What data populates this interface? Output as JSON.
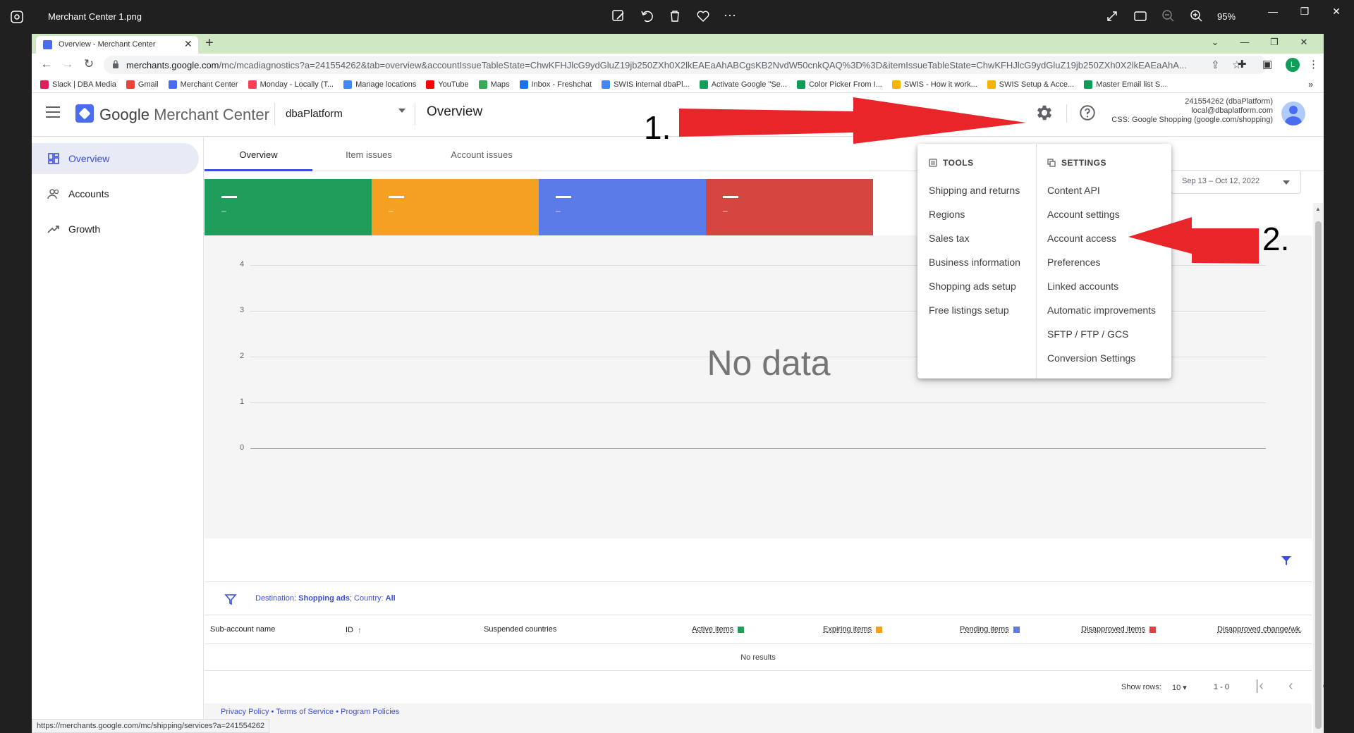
{
  "viewer": {
    "file_name": "Merchant Center 1.png",
    "zoom": "95%"
  },
  "browser": {
    "tab_title": "Overview - Merchant Center",
    "url_host": "merchants.google.com",
    "url_path": "/mc/mcadiagnostics?a=241554262&tab=overview&accountIssueTableState=ChwKFHJlcG9ydGluZ19jb250ZXh0X2lkEAEaAhABCgsKB2NvdW50cnkQAQ%3D%3D&itemIssueTableState=ChwKFHJlcG9ydGluZ19jb250ZXh0X2lkEAEaAhA...",
    "profile_initial": "L",
    "bookmarks": [
      {
        "label": "Slack | DBA Media",
        "color": "#e01e5a"
      },
      {
        "label": "Gmail",
        "color": "#ea4335"
      },
      {
        "label": "Merchant Center",
        "color": "#4a6cf0"
      },
      {
        "label": "Monday - Locally (T...",
        "color": "#ff3d57"
      },
      {
        "label": "Manage locations",
        "color": "#4285f4"
      },
      {
        "label": "YouTube",
        "color": "#ff0000"
      },
      {
        "label": "Maps",
        "color": "#34a853"
      },
      {
        "label": "Inbox - Freshchat",
        "color": "#1a73e8"
      },
      {
        "label": "SWIS internal dbaPl...",
        "color": "#4285f4"
      },
      {
        "label": "Activate Google \"Se...",
        "color": "#0f9d58"
      },
      {
        "label": "Color Picker From I...",
        "color": "#0f9d58"
      },
      {
        "label": "SWIS - How it work...",
        "color": "#f4b400"
      },
      {
        "label": "SWIS Setup & Acce...",
        "color": "#f4b400"
      },
      {
        "label": "Master Email list S...",
        "color": "#0f9d58"
      }
    ],
    "status_url": "https://merchants.google.com/mc/shipping/services?a=241554262"
  },
  "header": {
    "brand_google": "Google",
    "brand_product": "Merchant Center",
    "account_name": "dbaPlatform",
    "page_title": "Overview",
    "account_id_line": "241554262 (dbaPlatform)",
    "account_email": "local@dbaplatform.com",
    "css_line": "CSS: Google Shopping (google.com/shopping)"
  },
  "sidebar": {
    "items": [
      {
        "label": "Overview",
        "icon": "dashboard-icon",
        "active": true
      },
      {
        "label": "Accounts",
        "icon": "people-icon",
        "active": false
      },
      {
        "label": "Growth",
        "icon": "trending-up-icon",
        "active": false
      }
    ]
  },
  "content": {
    "tabs": [
      "Overview",
      "Item issues",
      "Account issues"
    ],
    "date_range": "Sep 13 – Oct 12, 2022",
    "stat_cards": [
      {
        "value": "—",
        "sub": "–",
        "color": "#1e9e5a"
      },
      {
        "value": "—",
        "sub": "–",
        "color": "#f4a020"
      },
      {
        "value": "—",
        "sub": "–",
        "color": "#5b7be8"
      },
      {
        "value": "—",
        "sub": "–",
        "color": "#d4463f"
      }
    ],
    "chart_y_labels": [
      "4",
      "3",
      "2",
      "1",
      "0"
    ],
    "no_data": "No data",
    "filter_prefix": "Destination: ",
    "filter_destination": "Shopping ads",
    "filter_mid": "; Country: ",
    "filter_country": "All",
    "table_columns": [
      {
        "label": "Sub-account name"
      },
      {
        "label": "ID",
        "sort": "↑"
      },
      {
        "label": "Suspended countries"
      },
      {
        "label": "Active items",
        "color": "#1e9e5a"
      },
      {
        "label": "Expiring items",
        "color": "#f4a020"
      },
      {
        "label": "Pending items",
        "color": "#5b7be8"
      },
      {
        "label": "Disapproved items",
        "color": "#d4463f"
      },
      {
        "label": "Disapproved change/wk."
      }
    ],
    "no_results": "No results",
    "show_rows_label": "Show rows:",
    "show_rows_value": "10",
    "page_range": "1 - 0"
  },
  "footer": {
    "privacy": "Privacy Policy",
    "terms": "Terms of Service",
    "program": "Program Policies"
  },
  "menu": {
    "tools_header": "TOOLS",
    "settings_header": "SETTINGS",
    "tools": [
      "Shipping and returns",
      "Regions",
      "Sales tax",
      "Business information",
      "Shopping ads setup",
      "Free listings setup"
    ],
    "settings": [
      "Content API",
      "Account settings",
      "Account access",
      "Preferences",
      "Linked accounts",
      "Automatic improvements",
      "SFTP / FTP / GCS",
      "Conversion Settings"
    ]
  },
  "annotations": {
    "step1": "1.",
    "step2": "2.",
    "arrow_color": "#e8262a"
  }
}
